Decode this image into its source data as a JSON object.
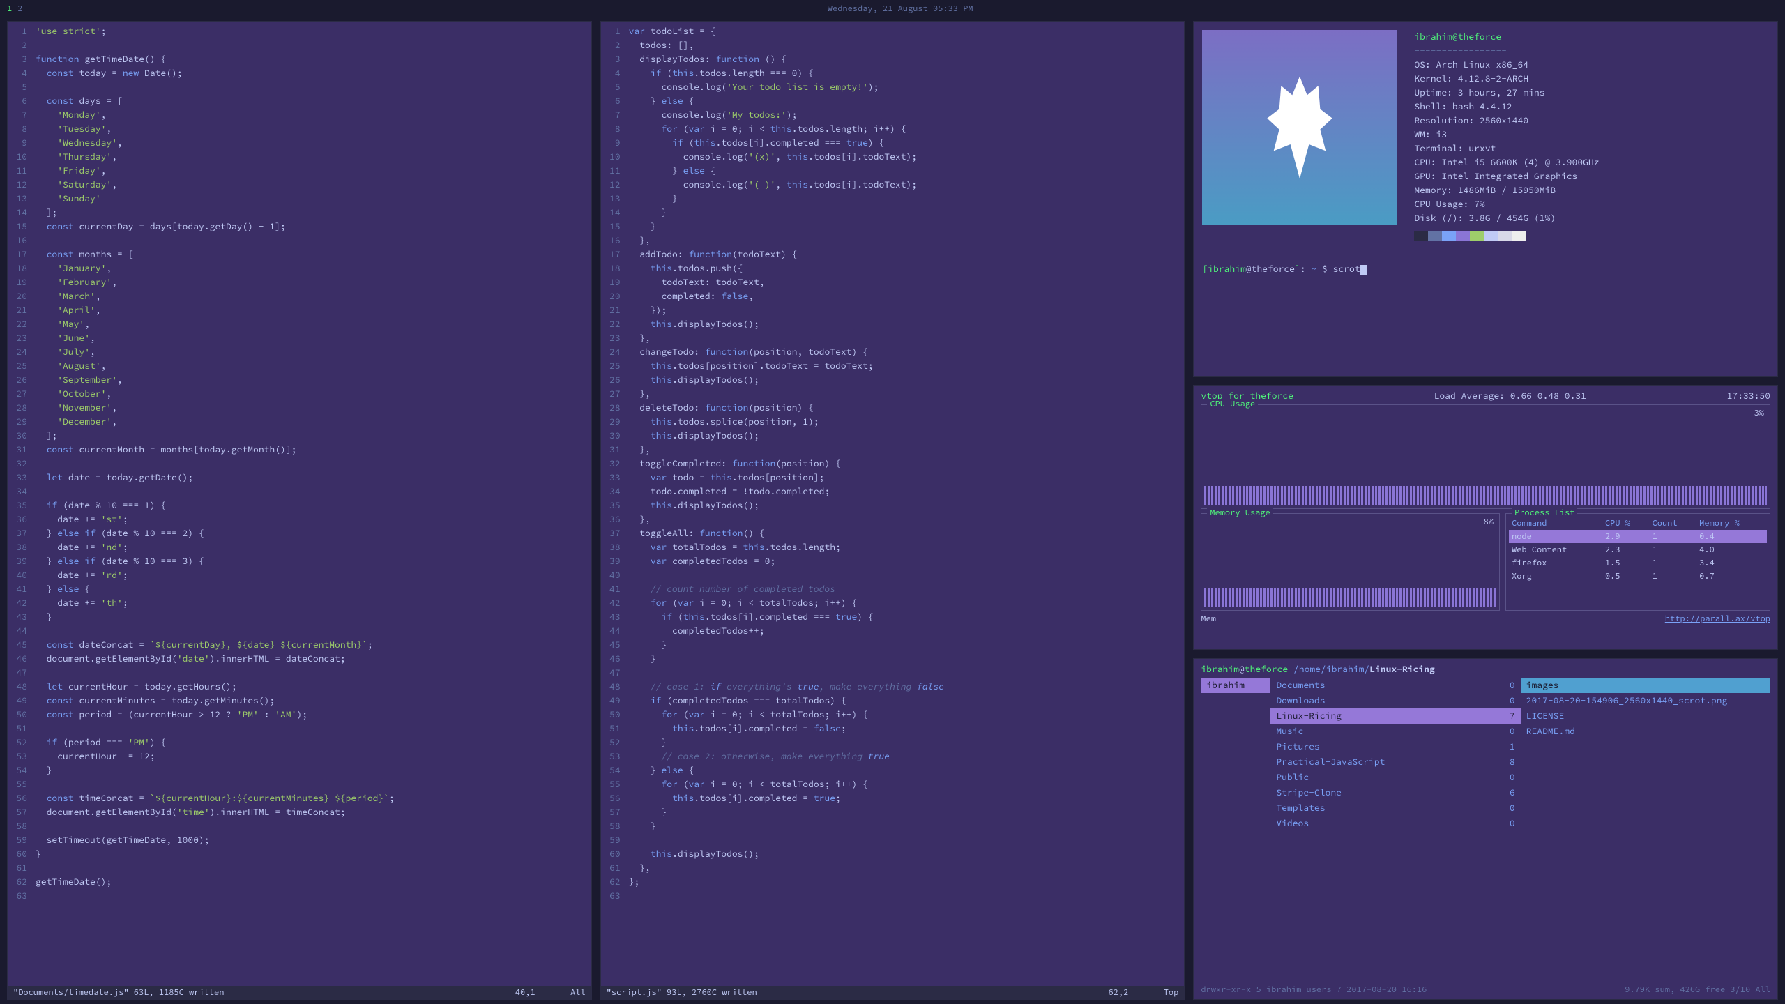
{
  "topbar": {
    "workspaces": [
      "1",
      "2"
    ],
    "active_workspace": 0,
    "datetime": "Wednesday, 21 August 05:33 PM"
  },
  "editor1": {
    "lines": [
      {
        "n": 1,
        "t": "'use strict';",
        "h": [
          "str"
        ]
      },
      {
        "n": 2,
        "t": ""
      },
      {
        "n": 3,
        "t": "function getTimeDate() {"
      },
      {
        "n": 4,
        "t": "  const today = new Date();"
      },
      {
        "n": 5,
        "t": ""
      },
      {
        "n": 6,
        "t": "  const days = ["
      },
      {
        "n": 7,
        "t": "    'Monday',"
      },
      {
        "n": 8,
        "t": "    'Tuesday',"
      },
      {
        "n": 9,
        "t": "    'Wednesday',"
      },
      {
        "n": 10,
        "t": "    'Thursday',"
      },
      {
        "n": 11,
        "t": "    'Friday',"
      },
      {
        "n": 12,
        "t": "    'Saturday',"
      },
      {
        "n": 13,
        "t": "    'Sunday'"
      },
      {
        "n": 14,
        "t": "  ];"
      },
      {
        "n": 15,
        "t": "  const currentDay = days[today.getDay() - 1];"
      },
      {
        "n": 16,
        "t": ""
      },
      {
        "n": 17,
        "t": "  const months = ["
      },
      {
        "n": 18,
        "t": "    'January',"
      },
      {
        "n": 19,
        "t": "    'February',"
      },
      {
        "n": 20,
        "t": "    'March',"
      },
      {
        "n": 21,
        "t": "    'April',"
      },
      {
        "n": 22,
        "t": "    'May',"
      },
      {
        "n": 23,
        "t": "    'June',"
      },
      {
        "n": 24,
        "t": "    'July',"
      },
      {
        "n": 25,
        "t": "    'August',"
      },
      {
        "n": 26,
        "t": "    'September',"
      },
      {
        "n": 27,
        "t": "    'October',"
      },
      {
        "n": 28,
        "t": "    'November',"
      },
      {
        "n": 29,
        "t": "    'December',"
      },
      {
        "n": 30,
        "t": "  ];"
      },
      {
        "n": 31,
        "t": "  const currentMonth = months[today.getMonth()];"
      },
      {
        "n": 32,
        "t": ""
      },
      {
        "n": 33,
        "t": "  let date = today.getDate();"
      },
      {
        "n": 34,
        "t": ""
      },
      {
        "n": 35,
        "t": "  if (date % 10 === 1) {"
      },
      {
        "n": 36,
        "t": "    date += 'st';"
      },
      {
        "n": 37,
        "t": "  } else if (date % 10 === 2) {"
      },
      {
        "n": 38,
        "t": "    date += 'nd';"
      },
      {
        "n": 39,
        "t": "  } else if (date % 10 === 3) {"
      },
      {
        "n": 40,
        "t": "    date += 'rd';"
      },
      {
        "n": 41,
        "t": "  } else {"
      },
      {
        "n": 42,
        "t": "    date += 'th';"
      },
      {
        "n": 43,
        "t": "  }"
      },
      {
        "n": 44,
        "t": ""
      },
      {
        "n": 45,
        "t": "  const dateConcat = `${currentDay}, ${date} ${currentMonth}`;"
      },
      {
        "n": 46,
        "t": "  document.getElementById('date').innerHTML = dateConcat;"
      },
      {
        "n": 47,
        "t": ""
      },
      {
        "n": 48,
        "t": "  let currentHour = today.getHours();"
      },
      {
        "n": 49,
        "t": "  const currentMinutes = today.getMinutes();"
      },
      {
        "n": 50,
        "t": "  const period = (currentHour > 12 ? 'PM' : 'AM');"
      },
      {
        "n": 51,
        "t": ""
      },
      {
        "n": 52,
        "t": "  if (period === 'PM') {"
      },
      {
        "n": 53,
        "t": "    currentHour -= 12;"
      },
      {
        "n": 54,
        "t": "  }"
      },
      {
        "n": 55,
        "t": ""
      },
      {
        "n": 56,
        "t": "  const timeConcat = `${currentHour}:${currentMinutes} ${period}`;"
      },
      {
        "n": 57,
        "t": "  document.getElementById('time').innerHTML = timeConcat;"
      },
      {
        "n": 58,
        "t": ""
      },
      {
        "n": 59,
        "t": "  setTimeout(getTimeDate, 1000);"
      },
      {
        "n": 60,
        "t": "}"
      },
      {
        "n": 61,
        "t": ""
      },
      {
        "n": 62,
        "t": "getTimeDate();"
      },
      {
        "n": 63,
        "t": ""
      }
    ],
    "status_left": "\"Documents/timedate.js\" 63L, 1185C written",
    "status_pos": "40,1",
    "status_right": "All"
  },
  "editor2": {
    "lines": [
      {
        "n": 1,
        "t": "var todoList = {"
      },
      {
        "n": 2,
        "t": "  todos: [],"
      },
      {
        "n": 3,
        "t": "  displayTodos: function () {"
      },
      {
        "n": 4,
        "t": "    if (this.todos.length === 0) {"
      },
      {
        "n": 5,
        "t": "      console.log('Your todo list is empty!');"
      },
      {
        "n": 6,
        "t": "    } else {"
      },
      {
        "n": 7,
        "t": "      console.log('My todos:');"
      },
      {
        "n": 8,
        "t": "      for (var i = 0; i < this.todos.length; i++) {"
      },
      {
        "n": 9,
        "t": "        if (this.todos[i].completed === true) {"
      },
      {
        "n": 10,
        "t": "          console.log('(x)', this.todos[i].todoText);"
      },
      {
        "n": 11,
        "t": "        } else {"
      },
      {
        "n": 12,
        "t": "          console.log('( )', this.todos[i].todoText);"
      },
      {
        "n": 13,
        "t": "        }"
      },
      {
        "n": 14,
        "t": "      }"
      },
      {
        "n": 15,
        "t": "    }"
      },
      {
        "n": 16,
        "t": "  },"
      },
      {
        "n": 17,
        "t": "  addTodo: function(todoText) {"
      },
      {
        "n": 18,
        "t": "    this.todos.push({"
      },
      {
        "n": 19,
        "t": "      todoText: todoText,"
      },
      {
        "n": 20,
        "t": "      completed: false,"
      },
      {
        "n": 21,
        "t": "    });"
      },
      {
        "n": 22,
        "t": "    this.displayTodos();"
      },
      {
        "n": 23,
        "t": "  },"
      },
      {
        "n": 24,
        "t": "  changeTodo: function(position, todoText) {"
      },
      {
        "n": 25,
        "t": "    this.todos[position].todoText = todoText;"
      },
      {
        "n": 26,
        "t": "    this.displayTodos();"
      },
      {
        "n": 27,
        "t": "  },"
      },
      {
        "n": 28,
        "t": "  deleteTodo: function(position) {"
      },
      {
        "n": 29,
        "t": "    this.todos.splice(position, 1);"
      },
      {
        "n": 30,
        "t": "    this.displayTodos();"
      },
      {
        "n": 31,
        "t": "  },"
      },
      {
        "n": 32,
        "t": "  toggleCompleted: function(position) {"
      },
      {
        "n": 33,
        "t": "    var todo = this.todos[position];"
      },
      {
        "n": 34,
        "t": "    todo.completed = !todo.completed;"
      },
      {
        "n": 35,
        "t": "    this.displayTodos();"
      },
      {
        "n": 36,
        "t": "  },"
      },
      {
        "n": 37,
        "t": "  toggleAll: function() {"
      },
      {
        "n": 38,
        "t": "    var totalTodos = this.todos.length;"
      },
      {
        "n": 39,
        "t": "    var completedTodos = 0;"
      },
      {
        "n": 40,
        "t": ""
      },
      {
        "n": 41,
        "t": "    // count number of completed todos"
      },
      {
        "n": 42,
        "t": "    for (var i = 0; i < totalTodos; i++) {"
      },
      {
        "n": 43,
        "t": "      if (this.todos[i].completed === true) {"
      },
      {
        "n": 44,
        "t": "        completedTodos++;"
      },
      {
        "n": 45,
        "t": "      }"
      },
      {
        "n": 46,
        "t": "    }"
      },
      {
        "n": 47,
        "t": ""
      },
      {
        "n": 48,
        "t": "    // case 1: if everything's true, make everything false"
      },
      {
        "n": 49,
        "t": "    if (completedTodos === totalTodos) {"
      },
      {
        "n": 50,
        "t": "      for (var i = 0; i < totalTodos; i++) {"
      },
      {
        "n": 51,
        "t": "        this.todos[i].completed = false;"
      },
      {
        "n": 52,
        "t": "      }"
      },
      {
        "n": 53,
        "t": "      // case 2: otherwise, make everything true"
      },
      {
        "n": 54,
        "t": "    } else {"
      },
      {
        "n": 55,
        "t": "      for (var i = 0; i < totalTodos; i++) {"
      },
      {
        "n": 56,
        "t": "        this.todos[i].completed = true;"
      },
      {
        "n": 57,
        "t": "      }"
      },
      {
        "n": 58,
        "t": "    }"
      },
      {
        "n": 59,
        "t": ""
      },
      {
        "n": 60,
        "t": "    this.displayTodos();"
      },
      {
        "n": 61,
        "t": "  },"
      },
      {
        "n": 62,
        "t": "};"
      },
      {
        "n": 63,
        "t": ""
      }
    ],
    "status_left": "\"script.js\" 93L, 2760C written",
    "status_pos": "62,2",
    "status_right": "Top"
  },
  "neofetch": {
    "user_host": "ibrahim@theforce",
    "dashes": "-----------------",
    "info": [
      "OS: Arch Linux x86_64",
      "Kernel: 4.12.8-2-ARCH",
      "Uptime: 3 hours, 27 mins",
      "Shell: bash 4.4.12",
      "Resolution: 2560x1440",
      "WM: i3",
      "Terminal: urxvt",
      "CPU: Intel i5-6600K (4) @ 3.900GHz",
      "GPU: Intel Integrated Graphics",
      "Memory: 1486MiB / 15950MiB",
      "CPU Usage: 7%",
      "Disk (/): 3.8G / 454G (1%)"
    ],
    "swatches": [
      "#2b2b45",
      "#6272a4",
      "#7aa2f7",
      "#8a75d6",
      "#9ece6a",
      "#c0caf5",
      "#d8d8e8",
      "#eeeeee"
    ],
    "prompt_user": "ibrahim",
    "prompt_host": "theforce",
    "prompt_path": "~",
    "prompt_sep": "$",
    "prompt_cmd": "scrot"
  },
  "vtop": {
    "title_left": "vtop for theforce",
    "load_avg": "Load Average: 0.66 0.48 0.31",
    "time": "17:33:50",
    "cpu_label": "CPU Usage",
    "cpu_pct": "3%",
    "mem_label": "Memory Usage",
    "mem_pct": "8%",
    "proc_label": "Process List",
    "proc_headers": [
      "Command",
      "CPU %",
      "Count",
      "Memory %"
    ],
    "processes": [
      {
        "cmd": "node",
        "cpu": "2.9",
        "count": "1",
        "mem": "0.4",
        "sel": true
      },
      {
        "cmd": "Web Content",
        "cpu": "2.3",
        "count": "1",
        "mem": "4.0"
      },
      {
        "cmd": "firefox",
        "cpu": "1.5",
        "count": "1",
        "mem": "3.4"
      },
      {
        "cmd": "Xorg",
        "cpu": "0.5",
        "count": "1",
        "mem": "0.7"
      }
    ],
    "foot_left": "Mem",
    "foot_link": "http://parall.ax/vtop"
  },
  "ranger": {
    "user": "ibrahim",
    "host": "theforce",
    "path_prefix": "/home/ibrahim/",
    "path_current": "Linux-Ricing",
    "col1": [
      {
        "label": "ibrahim",
        "sel": true
      }
    ],
    "col2": [
      {
        "label": "Documents",
        "count": "0"
      },
      {
        "label": "Downloads",
        "count": "0"
      },
      {
        "label": "Linux-Ricing",
        "count": "7",
        "sel": true
      },
      {
        "label": "Music",
        "count": "0"
      },
      {
        "label": "Pictures",
        "count": "1"
      },
      {
        "label": "Practical-JavaScript",
        "count": "8"
      },
      {
        "label": "Public",
        "count": "0"
      },
      {
        "label": "Stripe-Clone",
        "count": "6"
      },
      {
        "label": "Templates",
        "count": "0"
      },
      {
        "label": "Videos",
        "count": "0"
      }
    ],
    "col3": [
      {
        "label": "images",
        "sel": true,
        "header": true
      },
      {
        "label": "2017-08-20-154906_2560x1440_scrot.png"
      },
      {
        "label": "LICENSE"
      },
      {
        "label": "README.md"
      }
    ],
    "foot_left": "drwxr-xr-x 5 ibrahim users 7 2017-08-20 16:16",
    "foot_right": "9.79K sum, 426G free  3/10  All"
  }
}
